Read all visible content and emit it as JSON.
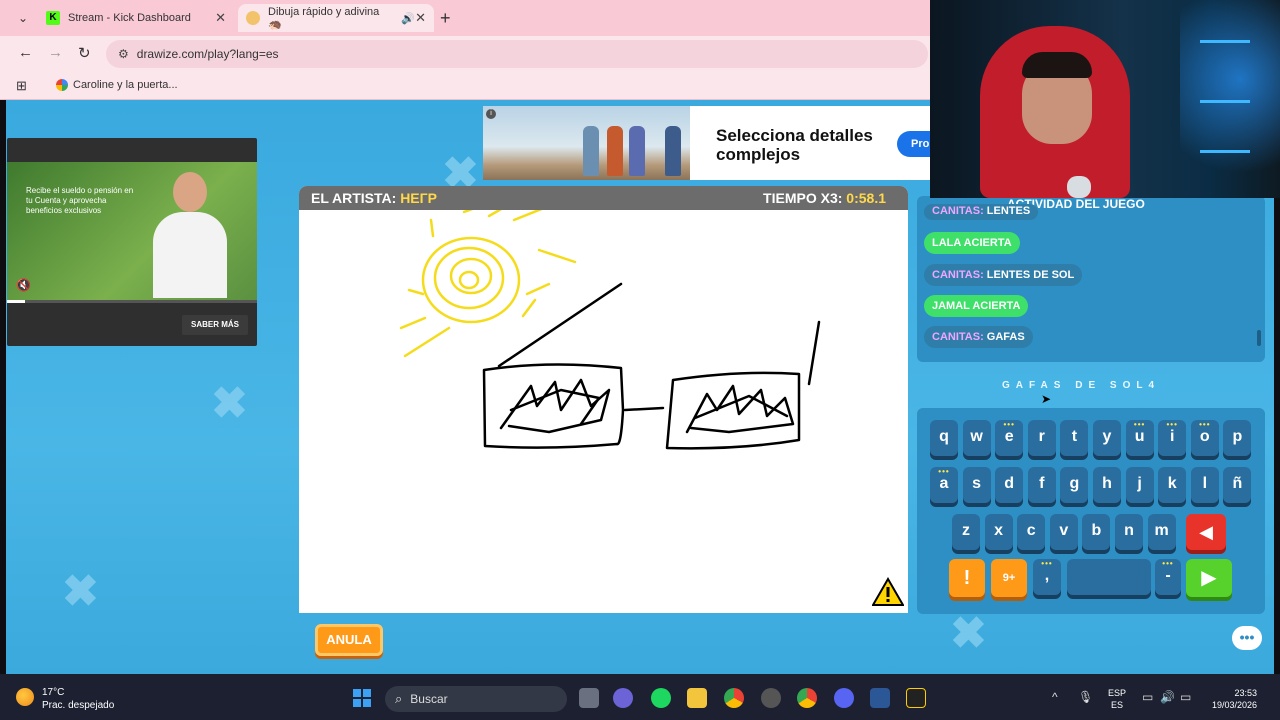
{
  "browser": {
    "tabs": [
      {
        "title": "Stream - Kick Dashboard",
        "favicon": "K"
      },
      {
        "title": "Dibuja rápido y adivina 🦔"
      }
    ],
    "url": "drawize.com/play?lang=es",
    "bookmark": "Caroline y la puerta..."
  },
  "ads": {
    "video_text": "Recibe el sueldo o pensión en tu Cuenta y aprovecha beneficios exclusivos",
    "video_cta": "SABER MÁS",
    "video_progress": 0.07,
    "banner_text": "Selecciona detalles complejos",
    "banner_button": "Pro"
  },
  "game": {
    "artist_label": "EL ARTISTA:",
    "artist_name": "НЕГР",
    "timer_label": "TIEMPO X3:",
    "timer_value": "0:58.1",
    "undo_button": "ANULA",
    "activity_title": "ACTIVIDAD DEL JUEGO",
    "activity": [
      {
        "kind": "guess",
        "who": "CANITAS:",
        "text": "LENTES"
      },
      {
        "kind": "ok",
        "text": "LALA ACIERTA"
      },
      {
        "kind": "guess",
        "who": "CANITAS:",
        "text": "LENTES DE SOL"
      },
      {
        "kind": "ok",
        "text": "JAMAL ACIERTA"
      },
      {
        "kind": "guess",
        "who": "CANITAS:",
        "text": "GAFAS"
      }
    ],
    "hint": "GAFAS DE SOL4",
    "keyboard": {
      "row1": [
        "q",
        "w",
        "e",
        "r",
        "t",
        "y",
        "u",
        "i",
        "o",
        "p"
      ],
      "row2": [
        "a",
        "s",
        "d",
        "f",
        "g",
        "h",
        "j",
        "k",
        "l",
        "ñ"
      ],
      "row3": [
        "z",
        "x",
        "c",
        "v",
        "b",
        "n",
        "m"
      ],
      "bomb_label": "9+",
      "comma": ",",
      "dash": "-"
    }
  },
  "taskbar": {
    "temp": "17°C",
    "weather": "Prac. despejado",
    "search": "Buscar",
    "lang1": "ESP",
    "lang2": "ES",
    "time": "23:53",
    "date": "19/03/2026"
  },
  "colors": {
    "accent_yellow": "#ffd94a",
    "guess_name": "#f0a6ff",
    "correct_green": "#3ee06a",
    "game_blue": "#3aa9de"
  }
}
